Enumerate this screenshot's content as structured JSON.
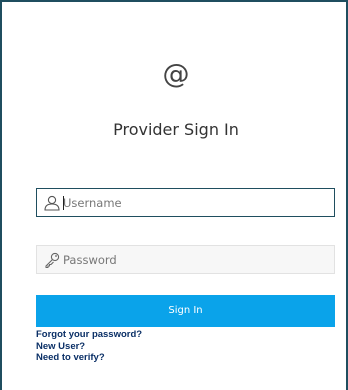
{
  "brand": {
    "logo_glyph": "@",
    "title": "Provider Sign In"
  },
  "form": {
    "username": {
      "placeholder": "Username",
      "value": "",
      "icon": "user-icon"
    },
    "password": {
      "placeholder": "Password",
      "value": "",
      "icon": "key-icon"
    },
    "submit_label": "Sign In"
  },
  "links": {
    "forgot": "Forgot your password?",
    "new_user": "New User?",
    "verify": "Need to verify?"
  },
  "colors": {
    "frame_border": "#1f4e5f",
    "button_bg": "#0aa3ea",
    "link": "#0a2f66"
  }
}
